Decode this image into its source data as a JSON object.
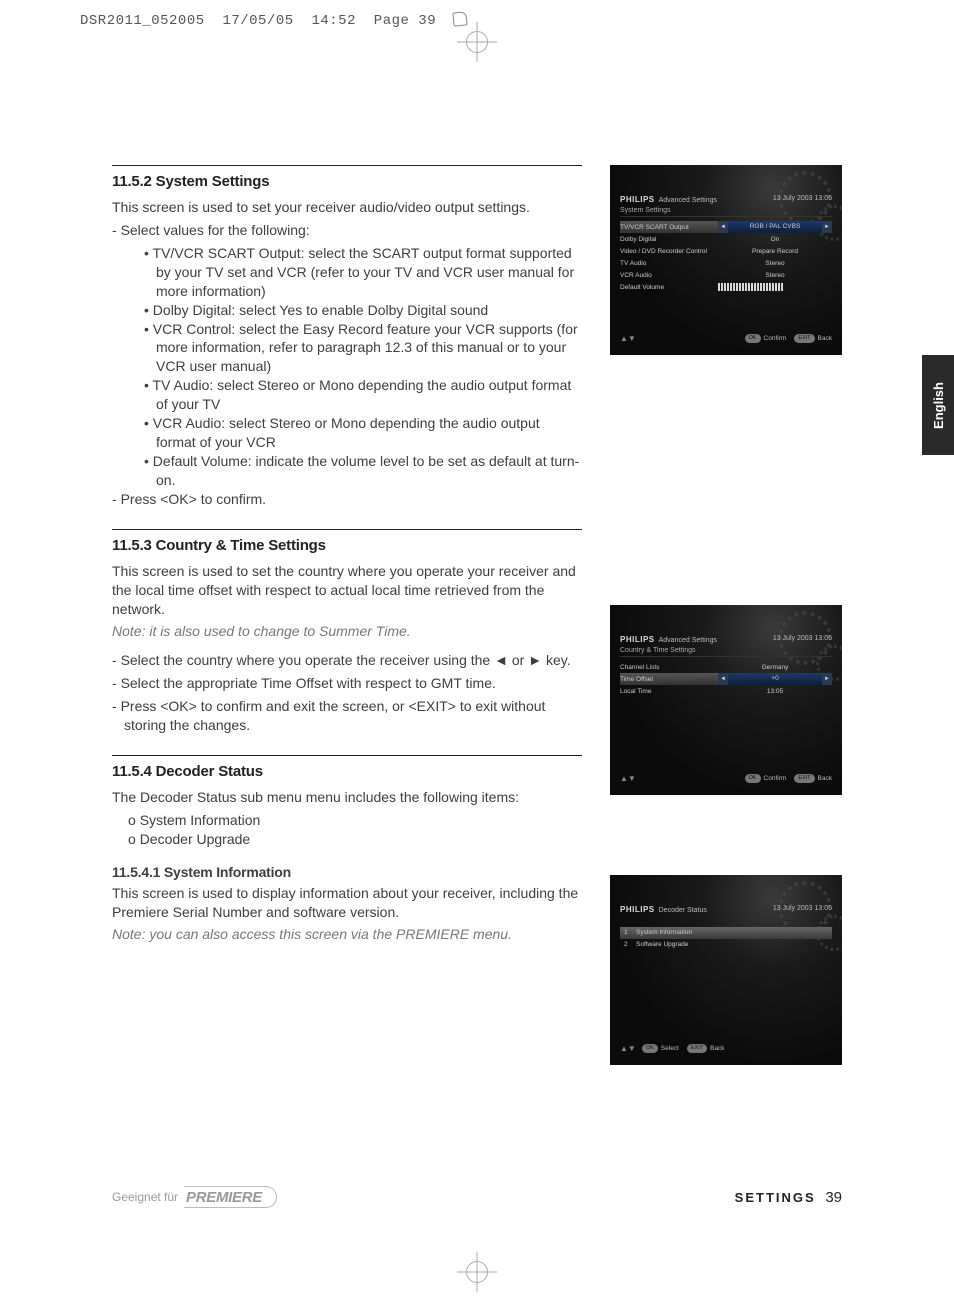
{
  "crop": {
    "file": "DSR2011_052005",
    "date": "17/05/05",
    "time": "14:52",
    "page_label": "Page 39"
  },
  "side_tab": "English",
  "sections": {
    "s1": {
      "heading": "11.5.2  System Settings",
      "intro": "This screen is used to set your receiver audio/video output settings.",
      "lead": "Select values for the following:",
      "items": [
        "TV/VCR SCART Output: select the SCART output format supported by your TV set and VCR (refer to your TV and VCR user manual for more information)",
        "Dolby Digital: select Yes to enable Dolby Digital sound",
        "VCR Control: select the Easy Record feature your VCR supports (for more information, refer to paragraph 12.3 of this manual or to your VCR user manual)",
        "TV Audio: select Stereo or Mono depending the audio output format of your TV",
        "VCR Audio: select Stereo or Mono depending the audio output format of your VCR",
        "Default Volume: indicate the volume level to be set as default at turn-on."
      ],
      "close": "Press <OK> to confirm."
    },
    "s2": {
      "heading": "11.5.3  Country & Time Settings",
      "intro": "This screen is used to set the country where you operate your receiver and the local time offset with respect to actual local time retrieved from the network.",
      "note": "Note: it is also used to change to Summer Time.",
      "items": [
        "Select the country where you operate the receiver using the ◄ or ►  key.",
        "Select the appropriate Time Offset with respect to GMT time.",
        "Press <OK> to confirm and exit the screen, or <EXIT> to exit without storing the changes."
      ]
    },
    "s3": {
      "heading": "11.5.4  Decoder Status",
      "intro": "The Decoder Status sub menu menu includes the following items:",
      "subitems": [
        "System Information",
        "Decoder Upgrade"
      ],
      "sub_heading": "11.5.4.1  System Information",
      "sub_text": "This screen is used to display information about your receiver, including the Premiere Serial Number and software version.",
      "sub_note": "Note: you can also access this screen via the PREMIERE menu."
    }
  },
  "tv1": {
    "brand": "PHILIPS",
    "title": "Advanced Settings",
    "date": "13 July 2003   13:05",
    "subtitle": "System Settings",
    "rows": [
      {
        "label": "TV/VCR SCART Output",
        "value": "RGB / PAL CVBS",
        "selected": true
      },
      {
        "label": "Dolby Digital",
        "value": "On"
      },
      {
        "label": "Video / DVD Recorder Control",
        "value": "Prepare Record"
      },
      {
        "label": "TV Audio",
        "value": "Stereo"
      },
      {
        "label": "VCR Audio",
        "value": "Stereo"
      },
      {
        "label": "Default Volume",
        "value": "__VOL__"
      }
    ],
    "footer": {
      "ok": "OK",
      "ok_label": "Confirm",
      "exit": "EXIT",
      "exit_label": "Back"
    }
  },
  "tv2": {
    "brand": "PHILIPS",
    "title": "Advanced Settings",
    "date": "13 July 2003   13:05",
    "subtitle": "Country & Time Settings",
    "rows": [
      {
        "label": "Channel Lists",
        "value": "Germany"
      },
      {
        "label": "Time Offset",
        "value": "+0",
        "selected": true
      },
      {
        "label": "Local Time",
        "value": "13:05"
      }
    ],
    "footer": {
      "ok": "OK",
      "ok_label": "Confirm",
      "exit": "EXIT",
      "exit_label": "Back"
    }
  },
  "tv3": {
    "brand": "PHILIPS",
    "title": "Decoder Status",
    "date": "13 July 2003   13:05",
    "menu": [
      {
        "num": "1",
        "label": "System Information",
        "selected": true
      },
      {
        "num": "2",
        "label": "Software Upgrade"
      }
    ],
    "footer": {
      "ok": "OK",
      "ok_label": "Select",
      "exit": "EXIT",
      "exit_label": "Back"
    }
  },
  "footer": {
    "left_text": "Geeignet für",
    "brand": "PREMIERE",
    "right_label": "SETTINGS",
    "page_num": "39"
  }
}
